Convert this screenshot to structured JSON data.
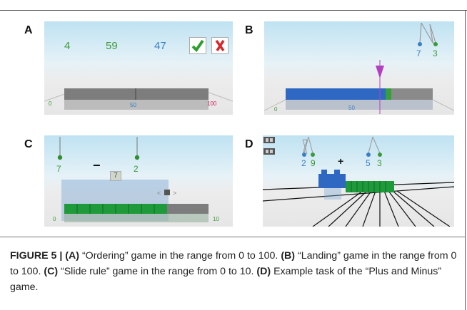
{
  "panels": {
    "A": {
      "letter": "A",
      "numbers": [
        "4",
        "59",
        "47"
      ],
      "check_icon": "check-icon",
      "cross_icon": "cross-icon"
    },
    "B": {
      "letter": "B",
      "left_digit": "7",
      "right_digit": "3"
    },
    "C": {
      "letter": "C",
      "left_digit": "7",
      "right_digit": "2",
      "minus": "−",
      "tile_value": "7"
    },
    "D": {
      "letter": "D",
      "pair1": [
        "2",
        "9"
      ],
      "pair2": [
        "5",
        "3"
      ],
      "plus": "+"
    }
  },
  "caption": {
    "fig_label": "FIGURE 5 | ",
    "a_label": "(A)",
    "a_text": " “Ordering” game in the range from 0 to 100. ",
    "b_label": "(B)",
    "b_text": " “Landing” game in the range from 0 to 100. ",
    "c_label": "(C)",
    "c_text": " “Slide rule” game in the range from 0 to 10. ",
    "d_label": "(D)",
    "d_text": " Example task of the “Plus and Minus” game."
  },
  "colors": {
    "green": "#3a9a3a",
    "blue": "#3a7fc4",
    "check_green": "#2e9e2e",
    "cross_red": "#d8262b",
    "pointer_magenta": "#b23fc0"
  }
}
